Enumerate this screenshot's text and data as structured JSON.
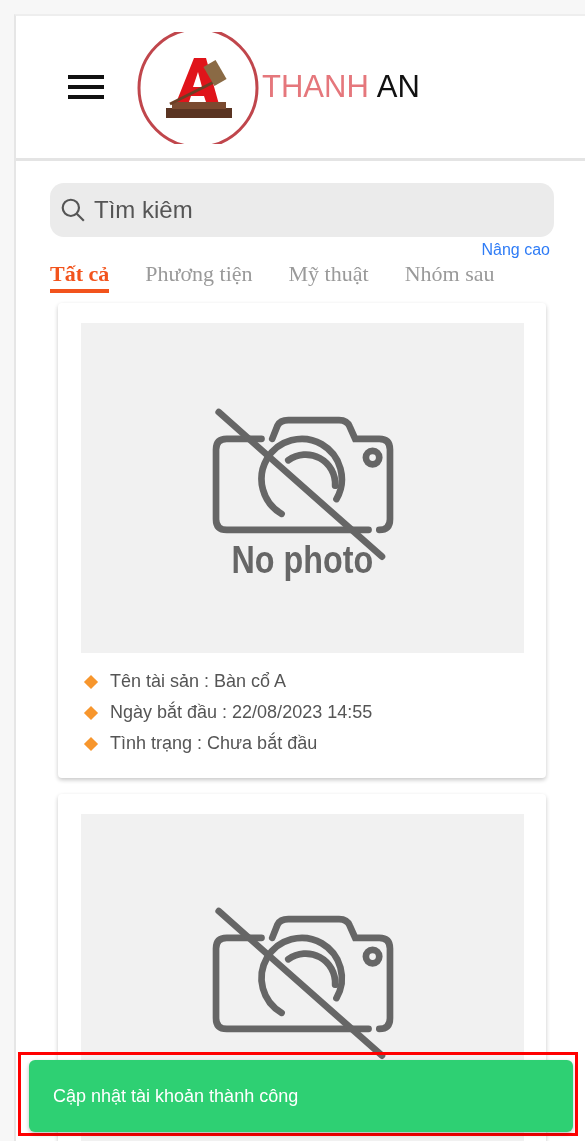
{
  "header": {
    "brand": [
      {
        "text": "THANH",
        "kind": "accent"
      },
      {
        "text": "AN",
        "kind": "plain"
      }
    ]
  },
  "search": {
    "placeholder": "Tìm kiêm"
  },
  "advanced_link": "Nâng cao",
  "tabs": [
    {
      "label": "Tất cả",
      "selected": true
    },
    {
      "label": "Phương tiện",
      "selected": false
    },
    {
      "label": "Mỹ thuật",
      "selected": false
    },
    {
      "label": "Nhóm sau",
      "selected": false
    }
  ],
  "cards": [
    {
      "kind": "detailed",
      "image_text": "No photo",
      "details": [
        "Tên tài sản : Bàn cổ A",
        "Ngày bắt đầu : 22/08/2023 14:55",
        "Tình trạng : Chưa bắt đầu"
      ]
    },
    {
      "kind": "image_only"
    }
  ],
  "toast": {
    "message": "Cập nhật tài khoản thành công",
    "highlighted": true
  }
}
